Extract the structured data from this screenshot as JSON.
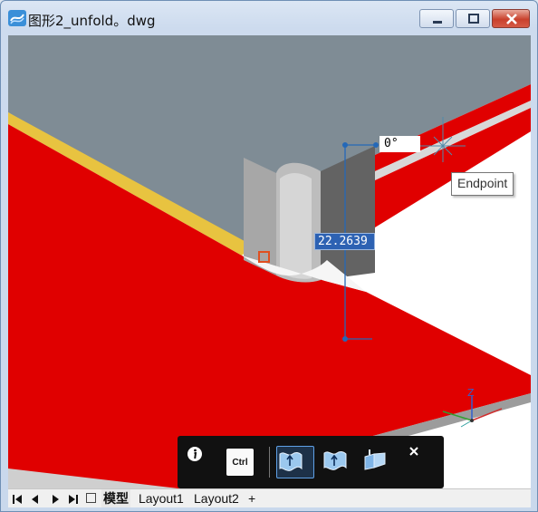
{
  "window": {
    "title": "图形2_unfold。dwg"
  },
  "colors": {
    "red_face": "#e00000",
    "gray_top": "#7f8c95",
    "yellow_edge": "#e8c340",
    "dim_line": "#2468b8",
    "selection_marker": "#e05020"
  },
  "drawing": {
    "angle_value": "0°",
    "length_value": "22.2639",
    "snap_tooltip": "Endpoint",
    "ucs_z_label": "Z"
  },
  "quad_toolbar": {
    "ctrl_label": "Ctrl",
    "icons": [
      "info-icon",
      "ctrl-key-icon",
      "flange-up-icon",
      "flange-down-icon",
      "bend-relief-icon",
      "close-icon"
    ]
  },
  "status_bar": {
    "nav_icons": [
      "first-tab-icon",
      "prev-tab-icon",
      "next-tab-icon",
      "last-tab-icon",
      "layout-list-icon"
    ],
    "tabs": [
      "模型",
      "Layout1",
      "Layout2"
    ],
    "add_tab_label": "+"
  }
}
